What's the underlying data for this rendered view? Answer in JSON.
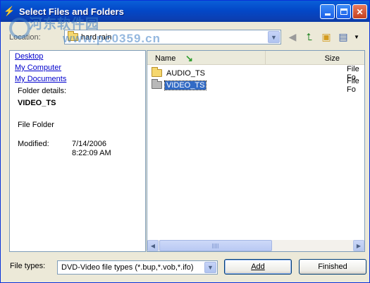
{
  "window": {
    "title": "Select Files and Folders"
  },
  "watermark": {
    "line1": "河东软件园",
    "line2": "www.pc0359.cn"
  },
  "location": {
    "label": "Location:",
    "value": "hard rain",
    "buttons": [
      "back-arrow-icon",
      "up-folder-icon",
      "new-folder-icon",
      "view-menu-icon"
    ]
  },
  "left_pane": {
    "links": [
      "Desktop",
      "My Computer",
      "My Documents"
    ],
    "details_heading": "Folder details:",
    "name": "VIDEO_TS",
    "type": "File Folder",
    "modified_label": "Modified:",
    "modified_date": "7/14/2006",
    "modified_time": "8:22:09 AM"
  },
  "file_list": {
    "columns": [
      "Name",
      "Size"
    ],
    "rows": [
      {
        "name": "AUDIO_TS",
        "type": "File Fo"
      },
      {
        "name": "VIDEO_TS",
        "type": "File Fo",
        "selected": true
      }
    ]
  },
  "footer": {
    "file_types_label": "File types:",
    "file_types_value": "DVD-Video file types (*.bup,*.vob,*.ifo)",
    "add_button": "Add",
    "finished_button": "Finished"
  },
  "colors": {
    "title_bar": "#0348c8",
    "selection": "#316ac5",
    "link": "#0000cc"
  }
}
